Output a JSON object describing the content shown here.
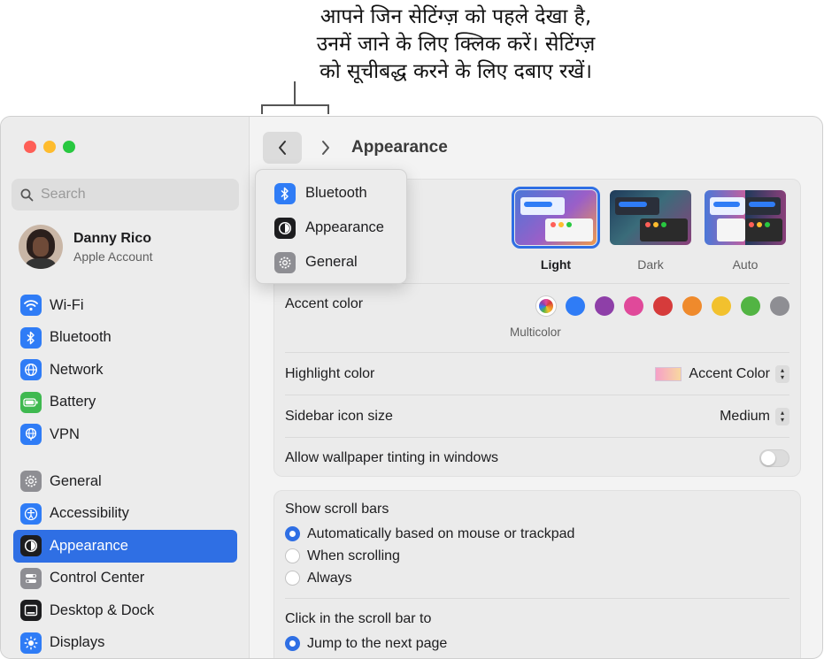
{
  "callout": {
    "line1": "आपने जिन सेटिंग्ज़ को पहले देखा है,",
    "line2": "उनमें जाने के लिए क्लिक करें। सेटिंग्ज़",
    "line3": "को सूचीबद्ध करने के लिए दबाए रखें।"
  },
  "window": {
    "search_placeholder": "Search",
    "account": {
      "name": "Danny Rico",
      "subtitle": "Apple Account"
    },
    "sidebar_group1": [
      {
        "label": "Wi-Fi",
        "icon": "wifi-icon",
        "color": "#2f7cf6"
      },
      {
        "label": "Bluetooth",
        "icon": "bluetooth-icon",
        "color": "#2f7cf6"
      },
      {
        "label": "Network",
        "icon": "globe-icon",
        "color": "#2f7cf6"
      },
      {
        "label": "Battery",
        "icon": "battery-icon",
        "color": "#3fb950"
      },
      {
        "label": "VPN",
        "icon": "vpn-globe-icon",
        "color": "#2f7cf6"
      }
    ],
    "sidebar_group2": [
      {
        "label": "General",
        "icon": "gear-icon",
        "color": "#8e8e93"
      },
      {
        "label": "Accessibility",
        "icon": "accessibility-icon",
        "color": "#2f7cf6"
      },
      {
        "label": "Appearance",
        "icon": "appearance-icon",
        "color": "#1d1d1f",
        "selected": true
      },
      {
        "label": "Control Center",
        "icon": "control-center-icon",
        "color": "#8e8e93"
      },
      {
        "label": "Desktop & Dock",
        "icon": "desktop-dock-icon",
        "color": "#1d1d1f"
      },
      {
        "label": "Displays",
        "icon": "brightness-icon",
        "color": "#2f7cf6"
      }
    ]
  },
  "main": {
    "title": "Appearance",
    "themes": [
      {
        "label": "Light",
        "selected": true
      },
      {
        "label": "Dark"
      },
      {
        "label": "Auto"
      }
    ],
    "accent": {
      "label": "Accent color",
      "caption": "Multicolor",
      "colors": [
        "multicolor",
        "#2f7cf6",
        "#8e3fa8",
        "#e0499a",
        "#d63b3b",
        "#ef8a2c",
        "#f2c12e",
        "#52b443",
        "#8e8e93"
      ]
    },
    "highlight": {
      "label": "Highlight color",
      "value": "Accent Color"
    },
    "icon_size": {
      "label": "Sidebar icon size",
      "value": "Medium"
    },
    "tinting": {
      "label": "Allow wallpaper tinting in windows",
      "on": false
    },
    "scroll_bars": {
      "title": "Show scroll bars",
      "options": [
        "Automatically based on mouse or trackpad",
        "When scrolling",
        "Always"
      ],
      "selected_index": 0
    },
    "click_scroll": {
      "title": "Click in the scroll bar to",
      "options": [
        "Jump to the next page"
      ],
      "selected_index": 0
    }
  },
  "history_popup": {
    "items": [
      {
        "label": "Bluetooth",
        "icon": "bluetooth-icon",
        "color": "#2f7cf6"
      },
      {
        "label": "Appearance",
        "icon": "appearance-icon",
        "color": "#1d1d1f"
      },
      {
        "label": "General",
        "icon": "gear-icon",
        "color": "#8e8e93"
      }
    ]
  }
}
